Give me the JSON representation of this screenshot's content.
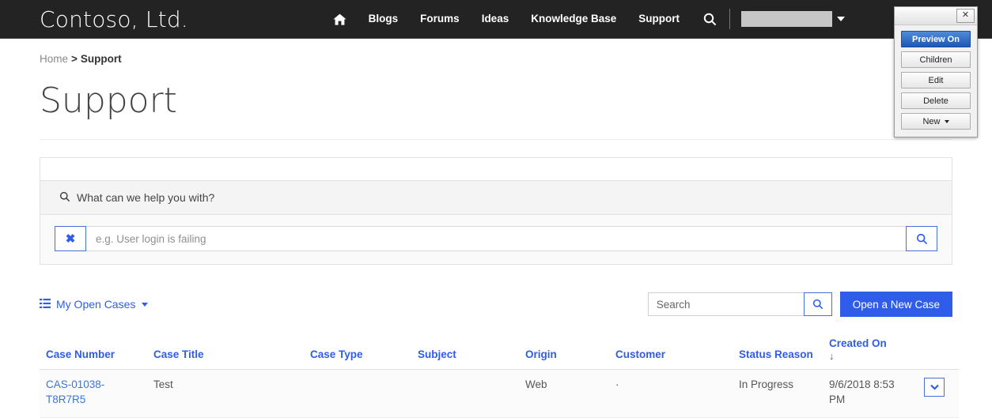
{
  "navbar": {
    "brand": "Contoso, Ltd.",
    "home_icon": "home-icon",
    "links": [
      "Blogs",
      "Forums",
      "Ideas",
      "Knowledge Base",
      "Support"
    ],
    "search_icon": "search-icon",
    "user_menu_caret": "chevron-down-icon"
  },
  "breadcrumb": {
    "home": "Home",
    "separator": ">",
    "current": "Support"
  },
  "page": {
    "title": "Support"
  },
  "help": {
    "heading": "What can we help you with?",
    "heading_icon": "search-icon",
    "clear_label": "✖",
    "input_value": "",
    "input_placeholder": "e.g. User login is failing",
    "submit_icon": "search-icon"
  },
  "cases_toolbar": {
    "view_icon": "list-icon",
    "view_label": "My Open Cases",
    "view_caret": "caret-down-icon",
    "search_value": "",
    "search_placeholder": "Search",
    "search_icon": "search-icon",
    "new_case_label": "Open a New Case"
  },
  "cases_table": {
    "columns": [
      "Case Number",
      "Case Title",
      "Case Type",
      "Subject",
      "Origin",
      "Customer",
      "Status Reason",
      "Created On",
      ""
    ],
    "sort_column": "Created On",
    "sort_arrow": "↓",
    "rows": [
      {
        "case_number": "CAS-01038-T8R7R5",
        "case_title": "Test",
        "case_type": "",
        "subject": "",
        "origin": "Web",
        "customer": "·",
        "status_reason": "In Progress",
        "created_on": "9/6/2018 8:53 PM",
        "row_menu_icon": "chevron-down-icon"
      }
    ]
  },
  "edit_panel": {
    "close_label": "✕",
    "buttons": [
      {
        "label": "Preview On",
        "primary": true,
        "caret": false
      },
      {
        "label": "Children",
        "primary": false,
        "caret": false
      },
      {
        "label": "Edit",
        "primary": false,
        "caret": false
      },
      {
        "label": "Delete",
        "primary": false,
        "caret": false
      },
      {
        "label": "New",
        "primary": false,
        "caret": true
      }
    ]
  },
  "colors": {
    "navbar_bg": "#232323",
    "accent_blue": "#2f5ce8",
    "link_blue": "#3b74d6",
    "panel_primary": "#1f57b5",
    "page_bg": "#ffffff"
  }
}
